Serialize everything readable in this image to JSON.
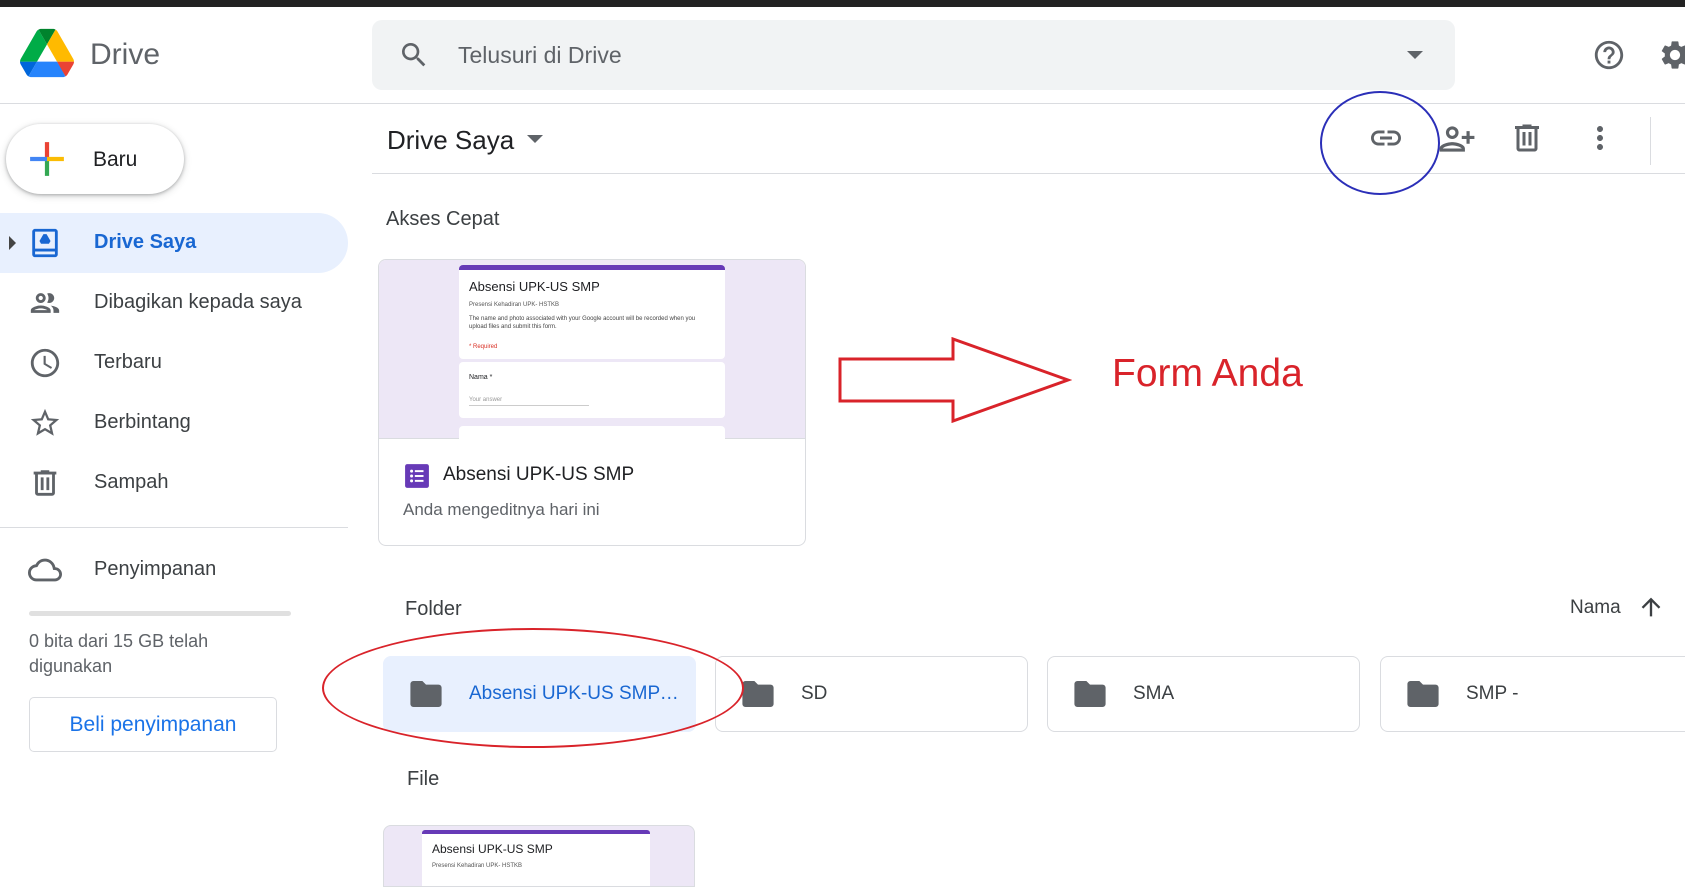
{
  "app": {
    "name": "Drive"
  },
  "search": {
    "placeholder": "Telusuri di Drive"
  },
  "sidebar": {
    "new_button": "Baru",
    "items": [
      {
        "label": "Drive Saya",
        "icon": "my-drive-icon",
        "active": true
      },
      {
        "label": "Dibagikan kepada saya",
        "icon": "shared-people-icon"
      },
      {
        "label": "Terbaru",
        "icon": "clock-icon"
      },
      {
        "label": "Berbintang",
        "icon": "star-icon"
      },
      {
        "label": "Sampah",
        "icon": "trash-icon"
      }
    ],
    "storage": {
      "label": "Penyimpanan",
      "usage_text": "0 bita dari 15 GB telah digunakan",
      "used_fraction": 0,
      "buy_button": "Beli penyimpanan"
    }
  },
  "main": {
    "title": "Drive Saya",
    "toolbar_icons": [
      "link-icon",
      "add-person-icon",
      "trash-icon",
      "more-vert-icon"
    ],
    "quick_access": {
      "heading": "Akses Cepat",
      "card": {
        "name": "Absensi UPK-US SMP",
        "subtitle": "Anda mengeditnya hari ini",
        "preview": {
          "title": "Absensi UPK-US SMP",
          "subtitle": "Presensi Kehadiran UPK- HSTKB",
          "description": "The name and photo associated with your Google account will be recorded when you upload files and submit this form.",
          "required": "* Required",
          "question": "Nama *",
          "answer_placeholder": "Your answer"
        }
      }
    },
    "folders": {
      "heading": "Folder",
      "sort_label": "Nama",
      "items": [
        {
          "name": "Absensi UPK-US SMP (File responses)",
          "selected": true
        },
        {
          "name": "SD"
        },
        {
          "name": "SMA"
        },
        {
          "name": "SMP -"
        }
      ]
    },
    "files": {
      "heading": "File",
      "items": [
        {
          "preview_title": "Absensi UPK-US SMP",
          "preview_subtitle": "Presensi Kehadiran UPK- HSTKB"
        }
      ]
    }
  },
  "annotation": {
    "text": "Form Anda",
    "color": "#d9232a",
    "circle_color": "#2b2fb8"
  },
  "colors": {
    "accent": "#1a73e8",
    "active_bg": "#e8f0fe",
    "forms_purple": "#673ab7"
  }
}
